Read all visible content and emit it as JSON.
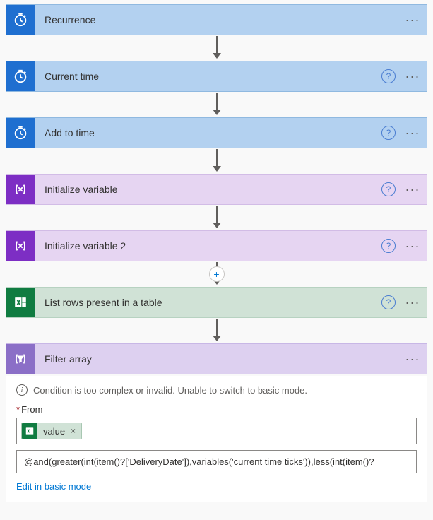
{
  "steps": {
    "recurrence": {
      "label": "Recurrence"
    },
    "current_time": {
      "label": "Current time"
    },
    "add_to_time": {
      "label": "Add to time"
    },
    "init_var": {
      "label": "Initialize variable"
    },
    "init_var2": {
      "label": "Initialize variable 2"
    },
    "list_rows": {
      "label": "List rows present in a table"
    },
    "filter_array": {
      "label": "Filter array"
    }
  },
  "icons": {
    "clock": "clock-icon",
    "variable": "variable-icon",
    "excel": "excel-icon",
    "filter": "filter-icon",
    "help": "?",
    "menu": "···",
    "add": "+"
  },
  "filter_panel": {
    "info_text": "Condition is too complex or invalid. Unable to switch to basic mode.",
    "from_label": "From",
    "required_marker": "*",
    "token_value": "value",
    "token_remove": "×",
    "expression": "@and(greater(int(item()?['DeliveryDate']),variables('current time ticks')),less(int(item()?",
    "edit_link": "Edit in basic mode"
  },
  "colors": {
    "schedule_bg": "#b3d1f0",
    "schedule_icon": "#1f6fd0",
    "variable_bg": "#e6d5f2",
    "variable_icon": "#7d2ec4",
    "excel_bg": "#d0e2d6",
    "excel_icon": "#107c41",
    "dataops_bg": "#ddd0f0",
    "dataops_icon": "#8b6fc7",
    "link": "#0078d4"
  }
}
